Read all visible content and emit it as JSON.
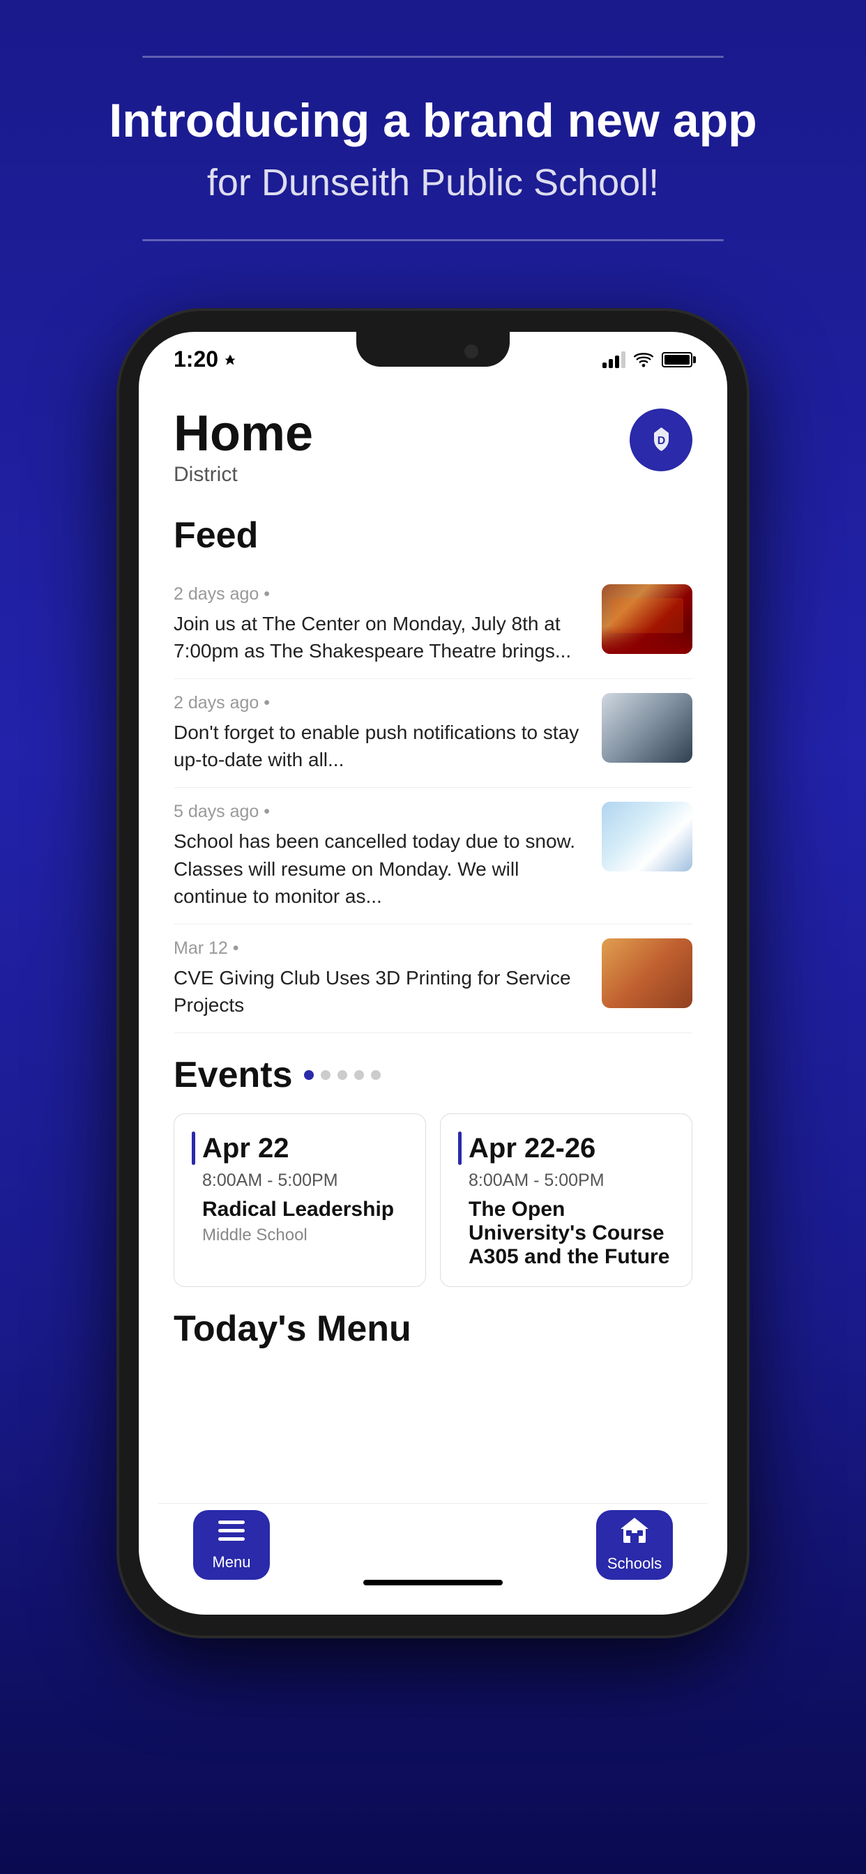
{
  "header": {
    "title_bold": "Introducing a brand new app",
    "title_regular": "for Dunseith Public School!",
    "divider_color": "rgba(255,255,255,0.3)"
  },
  "status_bar": {
    "time": "1:20",
    "location_arrow": "▲"
  },
  "app": {
    "home_title": "Home",
    "home_subtitle": "District",
    "logo_initials": "D",
    "feed_title": "Feed",
    "feed_items": [
      {
        "meta": "2 days ago • ",
        "text": "Join us at The Center on Monday, July 8th at 7:00pm as The Shakespeare Theatre brings...",
        "image_type": "theater"
      },
      {
        "meta": "2 days ago • ",
        "text": "Don't forget to enable push notifications to stay up-to-date with all...",
        "image_type": "phone"
      },
      {
        "meta": "5 days ago • ",
        "text": "School has been cancelled today due to snow. Classes will resume on Monday. We will continue to monitor as...",
        "image_type": "snow"
      },
      {
        "meta": "Mar 12 • ",
        "text": "CVE Giving Club Uses 3D Printing for Service Projects",
        "image_type": "kids"
      }
    ],
    "events_title": "Events",
    "events": [
      {
        "date": "Apr 22",
        "time": "8:00AM  -  5:00PM",
        "name": "Radical Leadership",
        "location": "Middle School"
      },
      {
        "date": "Apr 22-26",
        "time": "8:00AM  -  5:00PM",
        "name": "The Open University's Course A305 and the Future",
        "location": ""
      }
    ],
    "menu_title": "Today's Menu",
    "tab_menu_label": "Menu",
    "tab_schools_label": "Schools"
  }
}
